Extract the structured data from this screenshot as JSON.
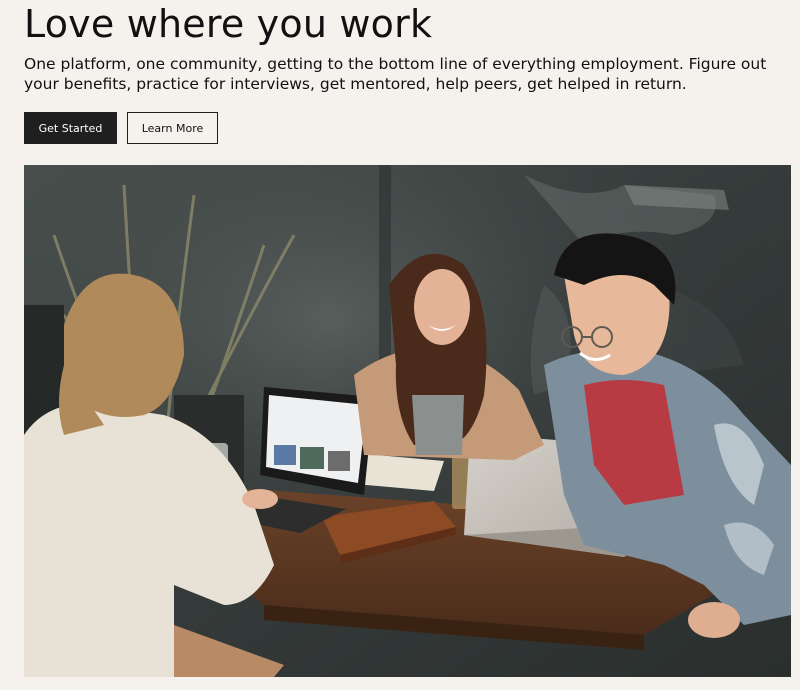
{
  "hero": {
    "title": "Love where you work",
    "subtitle": "One platform, one community, getting to the bottom line of everything employment. Figure out your benefits, practice for interviews, get mentored, help peers, get helped in return."
  },
  "actions": {
    "primary_label": "Get Started",
    "secondary_label": "Learn More"
  },
  "image": {
    "description_name": "three people laughing at a cafe table with laptops"
  },
  "colors": {
    "page_background": "#f5f2ee",
    "primary_button": "#1f1f1f",
    "text": "#111111"
  }
}
